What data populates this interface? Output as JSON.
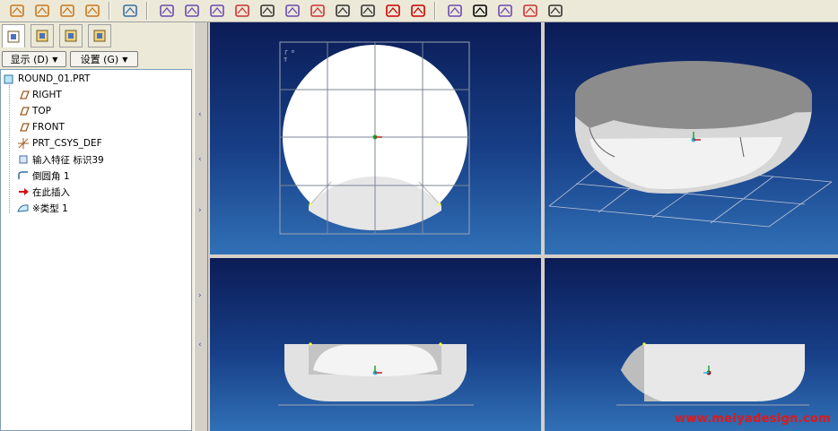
{
  "toolbar": {
    "buttons": [
      {
        "name": "datum-plane-display-icon",
        "color": "#c8781e"
      },
      {
        "name": "datum-axis-display-icon",
        "color": "#c8781e"
      },
      {
        "name": "datum-point-display-icon",
        "color": "#c8781e"
      },
      {
        "name": "coordinate-system-display-icon",
        "color": "#c8781e"
      },
      {
        "name": "spin-center-icon",
        "color": "#3c6ea5"
      },
      {
        "name": "analysis-measure-icon",
        "color": "#6a4ab0"
      },
      {
        "name": "analysis-model-icon",
        "color": "#6a4ab0"
      },
      {
        "name": "curvature-icon",
        "color": "#6a4ab0"
      },
      {
        "name": "shading-analysis-icon",
        "color": "#cc3333"
      },
      {
        "name": "draft-check-icon",
        "color": "#333333"
      },
      {
        "name": "section-icon",
        "color": "#6a4ab0"
      },
      {
        "name": "slope-analysis-icon",
        "color": "#cc3333"
      },
      {
        "name": "offset-icon",
        "color": "#333333"
      },
      {
        "name": "graph-icon",
        "color": "#333333"
      },
      {
        "name": "delete-analysis-icon",
        "color": "#cc0000"
      },
      {
        "name": "delete-all-analysis-icon",
        "color": "#cc0000"
      },
      {
        "name": "measure-curve-icon",
        "color": "#6a4ab0"
      },
      {
        "name": "whats-this-help-icon",
        "color": "#000000"
      },
      {
        "name": "reflection-analysis-icon",
        "color": "#6a4ab0"
      },
      {
        "name": "highlight-analysis-icon",
        "color": "#cc3333"
      },
      {
        "name": "saved-analysis-icon",
        "color": "#333333"
      }
    ]
  },
  "left_panel": {
    "tabs": [
      {
        "name": "tab-model-tree-icon",
        "active": true
      },
      {
        "name": "tab-folder-browser-icon",
        "active": false
      },
      {
        "name": "tab-favorites-icon",
        "active": false
      },
      {
        "name": "tab-connections-icon",
        "active": false
      }
    ],
    "show_menu_label": "显示 (D)",
    "settings_menu_label": "设置 (G)",
    "tree": [
      {
        "icon": "part-icon",
        "label": "ROUND_01.PRT",
        "indent": 0
      },
      {
        "icon": "datum-plane-icon",
        "label": "RIGHT",
        "indent": 1
      },
      {
        "icon": "datum-plane-icon",
        "label": "TOP",
        "indent": 1
      },
      {
        "icon": "datum-plane-icon",
        "label": "FRONT",
        "indent": 1
      },
      {
        "icon": "coordinate-system-icon",
        "label": "PRT_CSYS_DEF",
        "indent": 1
      },
      {
        "icon": "import-feature-icon",
        "label": "输入特征 标识39",
        "indent": 1
      },
      {
        "icon": "round-feature-icon",
        "label": "倒圆角 1",
        "indent": 1
      },
      {
        "icon": "insert-here-arrow-icon",
        "label": "在此插入",
        "indent": 1
      },
      {
        "icon": "style-feature-icon",
        "label": "※类型 1",
        "indent": 1
      }
    ]
  },
  "viewports": [
    {
      "name": "viewport-top-view",
      "view": "top"
    },
    {
      "name": "viewport-isometric-view",
      "view": "iso"
    },
    {
      "name": "viewport-front-view",
      "view": "front"
    },
    {
      "name": "viewport-side-view",
      "view": "side"
    }
  ],
  "colors": {
    "viewport_top": "#0b1c56",
    "viewport_bottom": "#3170b6",
    "watermark": "#e11818"
  },
  "watermark": "www.meiyadesign.com"
}
